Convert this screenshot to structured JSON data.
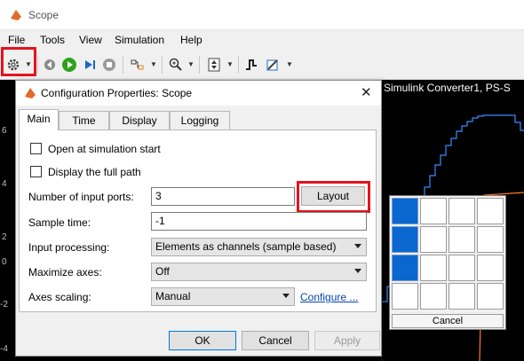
{
  "window": {
    "title": "Scope"
  },
  "menu": [
    "File",
    "Tools",
    "View",
    "Simulation",
    "Help"
  ],
  "plot": {
    "title": "Simulink Converter1, PS-S",
    "y_ticks": [
      "6",
      "4",
      "2",
      "0",
      "-2",
      "-4"
    ]
  },
  "dialog": {
    "title": "Configuration Properties: Scope",
    "tabs": [
      "Main",
      "Time",
      "Display",
      "Logging"
    ],
    "open_at_start_label": "Open at simulation start",
    "full_path_label": "Display the full path",
    "input_ports_label": "Number of input ports:",
    "input_ports_value": "3",
    "layout_button": "Layout",
    "sample_time_label": "Sample time:",
    "sample_time_value": "-1",
    "input_processing_label": "Input processing:",
    "input_processing_value": "Elements as channels (sample based)",
    "maximize_axes_label": "Maximize axes:",
    "maximize_axes_value": "Off",
    "axes_scaling_label": "Axes scaling:",
    "axes_scaling_value": "Manual",
    "configure_link": "Configure ...",
    "ok_button": "OK",
    "cancel_button": "Cancel",
    "apply_button": "Apply"
  },
  "layout_popup": {
    "cancel_label": "Cancel",
    "selected_cells": [
      "r1c1",
      "r2c1",
      "r3c1"
    ]
  },
  "colors": {
    "accent": "#0a67d0",
    "highlight": "#e3141e",
    "signal1": "#3a8cff",
    "signal2": "#ff7a2e"
  }
}
